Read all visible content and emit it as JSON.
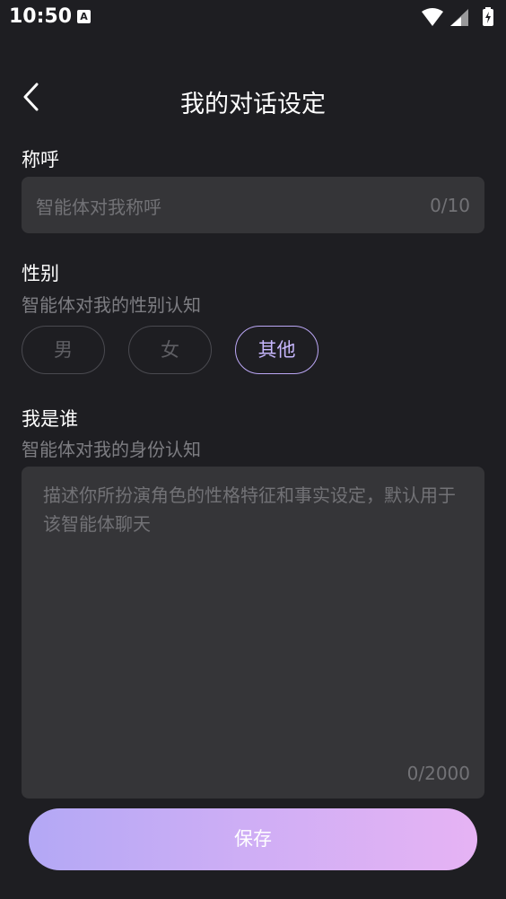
{
  "status_bar": {
    "time": "10:50",
    "notification_icon_letter": "A",
    "icons": [
      "wifi-icon",
      "signal-icon",
      "battery-charging-icon"
    ]
  },
  "header": {
    "title": "我的对话设定",
    "back_icon": "chevron-left-icon"
  },
  "nickname": {
    "label": "称呼",
    "placeholder": "智能体对我称呼",
    "counter": "0/10"
  },
  "gender": {
    "label": "性别",
    "hint": "智能体对我的性别认知",
    "options": [
      "男",
      "女",
      "其他"
    ],
    "selected": "其他"
  },
  "identity": {
    "label": "我是谁",
    "hint": "智能体对我的身份认知",
    "placeholder": "描述你所扮演角色的性格特征和事实设定，默认用于该智能体聊天",
    "counter": "0/2000"
  },
  "save_label": "保存",
  "colors": {
    "background": "#1e1e22",
    "field_background": "#353538",
    "accent": "#bba7f5",
    "button_gradient_start": "#b3a8f5",
    "button_gradient_end": "#e6b3f4"
  }
}
